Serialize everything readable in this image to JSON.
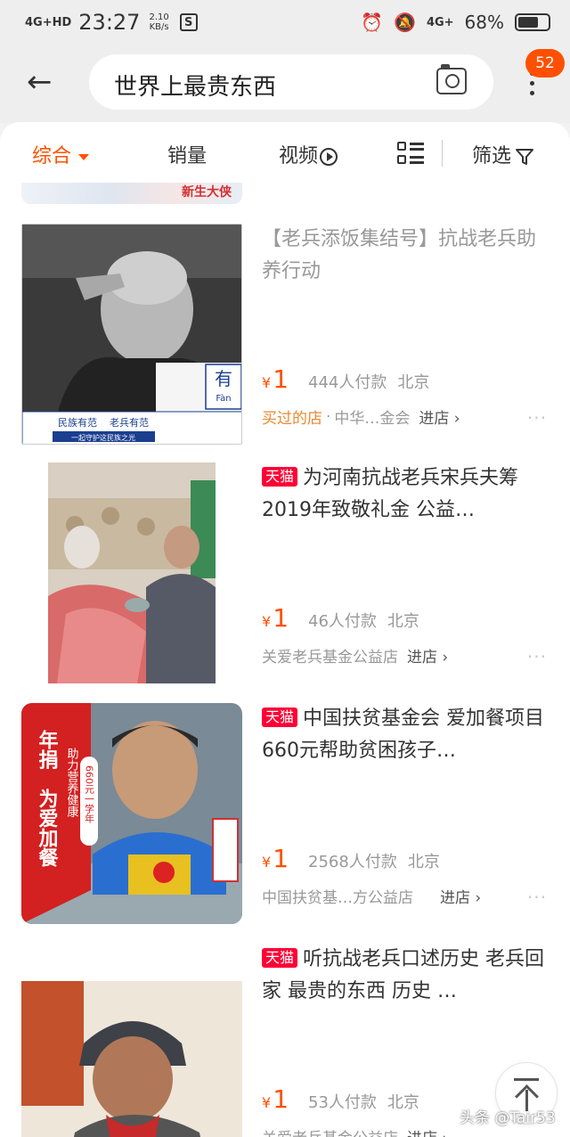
{
  "status_bar": {
    "network": "4G+HD",
    "time": "23:27",
    "speed_value": "2.10",
    "speed_unit": "KB/s",
    "s_icon": "S",
    "network_right": "4G+",
    "battery": "68%",
    "battery_level": 0.68
  },
  "header": {
    "search_query": "世界上最贵东西",
    "badge": "52"
  },
  "sortbar": {
    "comprehensive": "综合",
    "sales": "销量",
    "video": "视频",
    "filter": "筛选"
  },
  "partial_banner": "新生大侠",
  "items": [
    {
      "title": "【老兵添饭集结号】抗战老兵助养行动",
      "tmall": "",
      "yen": "¥",
      "price": "1",
      "paid": "444人付款",
      "location": "北京",
      "bought": "买过的店",
      "shop": "中华…金会",
      "enter": "进店",
      "thumb_text": [
        "民族有范",
        "老兵有范",
        "一起守护这民族之光",
        "有",
        "Fàn"
      ]
    },
    {
      "title": "为河南抗战老兵宋兵夫筹2019年致敬礼金 公益…",
      "tmall": "天猫",
      "yen": "¥",
      "price": "1",
      "paid": "46人付款",
      "location": "北京",
      "shop": "关爱老兵基金公益店",
      "enter": "进店"
    },
    {
      "title": "中国扶贫基金会 爱加餐项目 660元帮助贫困孩子…",
      "tmall": "天猫",
      "yen": "¥",
      "price": "1",
      "paid": "2568人付款",
      "location": "北京",
      "shop": "中国扶贫基…方公益店",
      "enter": "进店",
      "thumb_text": [
        "年捐",
        "为爱加餐",
        "助力营养健康",
        "660元一学年"
      ]
    },
    {
      "title": "听抗战老兵口述历史 老兵回家 最贵的东西 历史 …",
      "tmall": "天猫",
      "yen": "¥",
      "price": "1",
      "paid": "53人付款",
      "location": "北京",
      "shop": "关爱老兵基金公益店",
      "enter": "进店"
    }
  ],
  "more_dots": "···",
  "watermark": "头条 @Tair53",
  "colors": {
    "accent": "#ff5000",
    "tmall": "#ff0036"
  }
}
